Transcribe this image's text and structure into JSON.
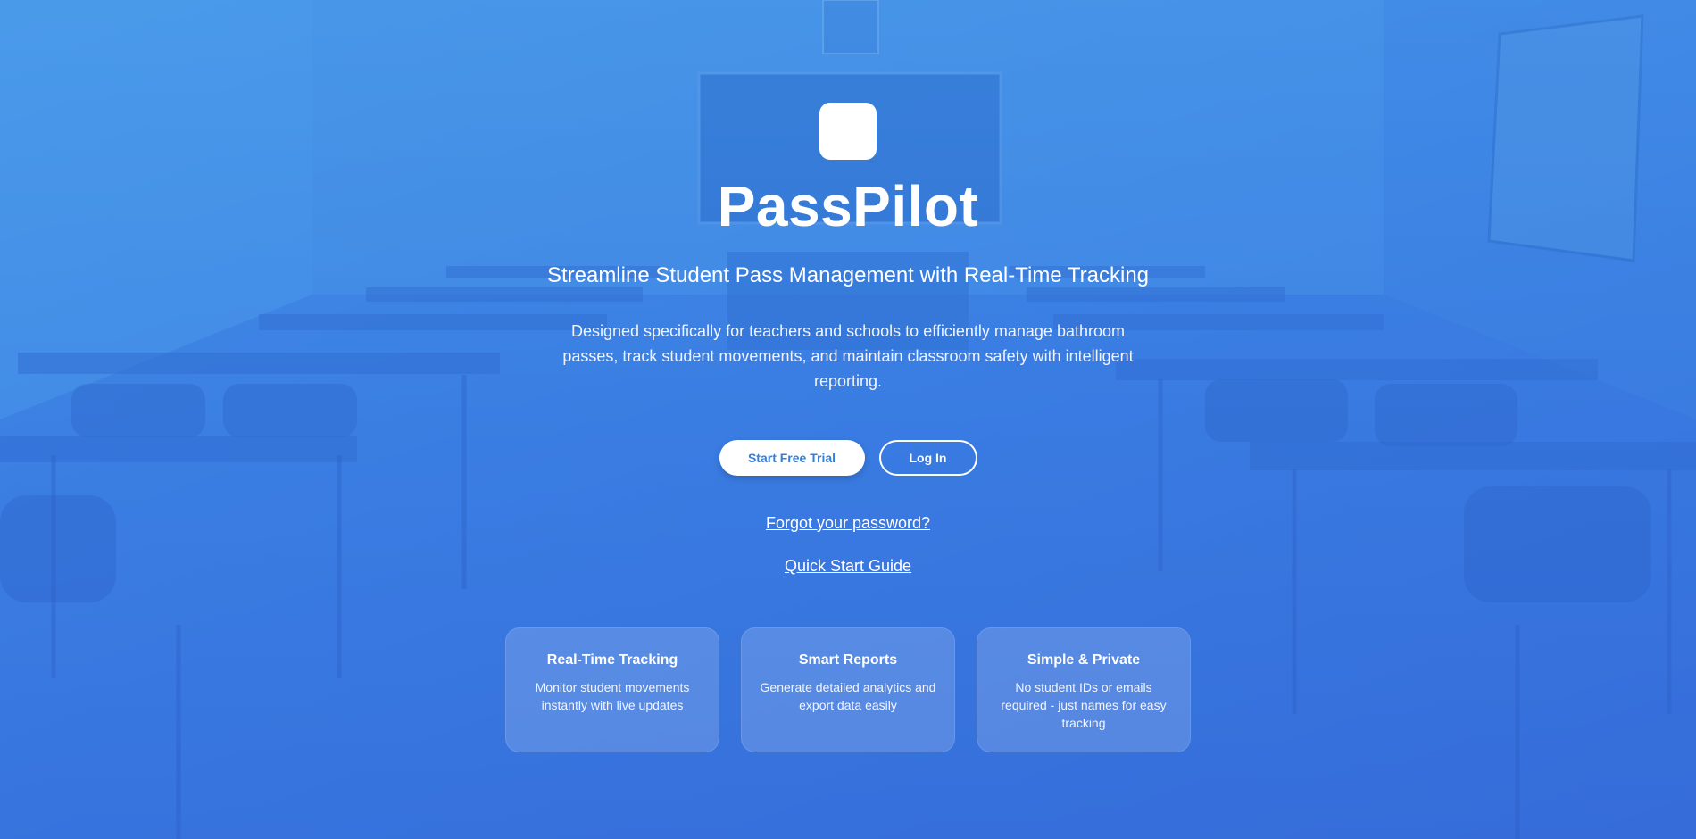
{
  "app": {
    "title": "PassPilot",
    "tagline": "Streamline Student Pass Management with Real-Time Tracking",
    "description": "Designed specifically for teachers and schools to efficiently manage bathroom passes, track student movements, and maintain classroom safety with intelligent reporting."
  },
  "actions": {
    "trial_label": "Start Free Trial",
    "login_label": "Log In",
    "forgot_label": "Forgot your password?",
    "guide_label": "Quick Start Guide"
  },
  "features": [
    {
      "title": "Real-Time Tracking",
      "desc": "Monitor student movements instantly with live updates"
    },
    {
      "title": "Smart Reports",
      "desc": "Generate detailed analytics and export data easily"
    },
    {
      "title": "Simple & Private",
      "desc": "No student IDs or emails required - just names for easy tracking"
    }
  ],
  "colors": {
    "background_top": "#4a9ee8",
    "background_bottom": "#3366d6",
    "primary_button_text": "#2f7fe0",
    "text": "#ffffff"
  }
}
